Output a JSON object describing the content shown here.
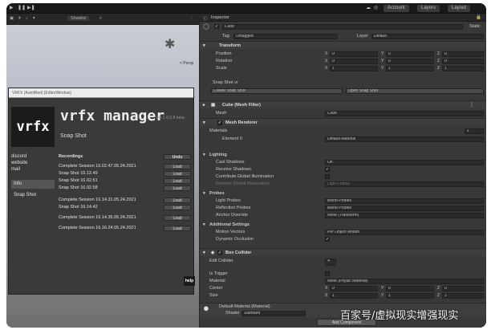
{
  "toolbar": {
    "account": "Account",
    "layers": "Layers",
    "layout": "Layout"
  },
  "scene": {
    "view_mode": "Shaded",
    "persp": "< Persp"
  },
  "vrfx": {
    "url": "VRFX (Autofilled) [EditorWindow]",
    "logo": "vrfx",
    "title": "vrfx manager",
    "version": "ver.1.0.0.8 beta",
    "snapshot_heading": "Snap Shot",
    "links": [
      "discord",
      "website",
      "mail"
    ],
    "info_button": "Info",
    "snapshot_button": "Snap Shot",
    "recordings_header": "Recordings",
    "undo_button": "Undo",
    "rows": [
      {
        "label": "Complete Session 16.02.47.05.24.2021",
        "button": "Load"
      },
      {
        "label": "Snap Shot 15.12.49",
        "button": "Load"
      },
      {
        "label": "Snap Shot 16.02.51",
        "button": "Load"
      },
      {
        "label": "Snap Shot 16.02.58",
        "button": "Load"
      },
      {
        "label": "Complete Session 16.14.31.05.24.2021",
        "button": "Load"
      },
      {
        "label": "Snap Shot 16.14.42",
        "button": "Load"
      },
      {
        "label": "Complete Session 16.14.35.05.24.2021",
        "button": "Load"
      },
      {
        "label": "Complete Session 16.16.24.05.24.2021",
        "button": "Load"
      }
    ],
    "help": "help"
  },
  "inspector": {
    "tab": "Inspector",
    "object_name": "Cube",
    "static": "Static",
    "tag_label": "Tag",
    "tag_value": "Untagged",
    "layer_label": "Layer",
    "layer_value": "Default",
    "transform": {
      "header": "Transform",
      "position": {
        "label": "Position",
        "x": "0",
        "y": "0",
        "z": "0"
      },
      "rotation": {
        "label": "Rotation",
        "x": "0",
        "y": "0",
        "z": "0"
      },
      "scale": {
        "label": "Scale",
        "x": "1",
        "y": "1",
        "z": "1"
      }
    },
    "snapshot": {
      "header": "Snap Shot vr",
      "create": "Create Snap Shot",
      "open": "Open Snap Shot"
    },
    "mesh_filter": {
      "header": "Cube (Mesh Filter)",
      "mesh_label": "Mesh",
      "mesh_value": "Cube"
    },
    "mesh_renderer": {
      "header": "Mesh Renderer",
      "materials_label": "Materials",
      "materials_count": "1",
      "element_label": "Element 0",
      "element_value": "Default-Material"
    },
    "lighting": {
      "header": "Lighting",
      "cast_shadows": {
        "label": "Cast Shadows",
        "value": "On"
      },
      "receive_shadows": "Receive Shadows",
      "contribute_gi": "Contribute Global Illumination",
      "receive_gi": {
        "label": "Receive Global Illumination",
        "value": "Light Probes"
      }
    },
    "probes": {
      "header": "Probes",
      "light": {
        "label": "Light Probes",
        "value": "Blend Probes"
      },
      "reflection": {
        "label": "Reflection Probes",
        "value": "Blend Probes"
      },
      "anchor": {
        "label": "Anchor Override",
        "value": "None (Transform)"
      }
    },
    "additional": {
      "header": "Additional Settings",
      "motion": {
        "label": "Motion Vectors",
        "value": "Per Object Motion"
      },
      "occlusion": "Dynamic Occlusion"
    },
    "box_collider": {
      "header": "Box Collider",
      "edit": "Edit Collider",
      "trigger": "Is Trigger",
      "material": {
        "label": "Material",
        "value": "None (Physic Material)"
      },
      "center": {
        "label": "Center",
        "x": "0",
        "y": "0",
        "z": "0"
      },
      "size": {
        "label": "Size",
        "x": "1",
        "y": "1",
        "z": "1"
      }
    },
    "material_footer": {
      "name": "Default-Material (Material)",
      "shader_label": "Shader",
      "shader_value": "Standard"
    },
    "add_component": "Add Component"
  },
  "watermark": "百家号/虚拟现实增强现实"
}
